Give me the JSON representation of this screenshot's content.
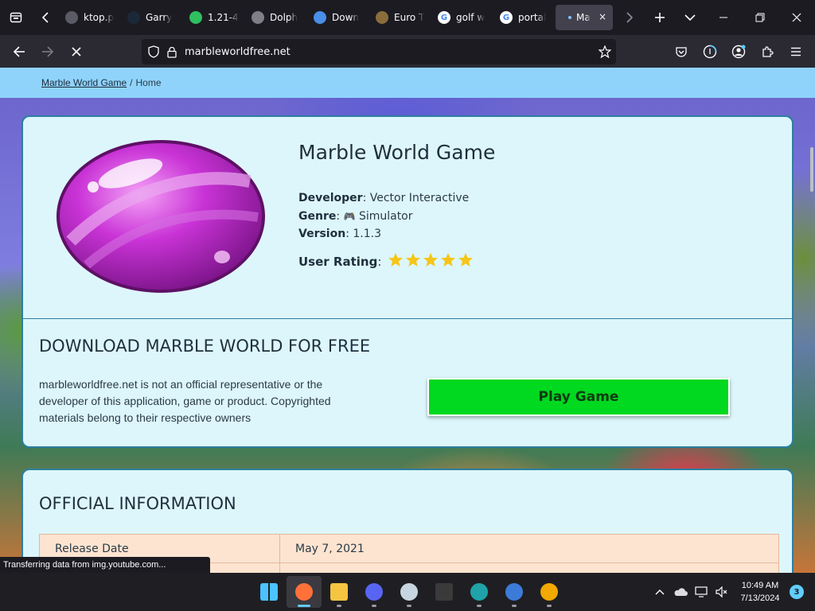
{
  "browser": {
    "tabs": [
      {
        "title": "ktop.p",
        "icon": "document-icon",
        "color": "#5b5b66"
      },
      {
        "title": "Garry",
        "icon": "steam-icon",
        "color": "#1b2838"
      },
      {
        "title": "1.21-4",
        "icon": "curseforge-icon",
        "color": "#2fbf5f"
      },
      {
        "title": "Dolph",
        "icon": "dolphin-icon",
        "color": "#7f7f88"
      },
      {
        "title": "Down",
        "icon": "download-icon",
        "color": "#4a8fe7"
      },
      {
        "title": "Euro T",
        "icon": "truck-icon",
        "color": "#8a6d3b"
      },
      {
        "title": "golf w",
        "icon": "google-icon",
        "color": "#ffffff"
      },
      {
        "title": "portal",
        "icon": "google-icon",
        "color": "#ffffff"
      }
    ],
    "active_tab": {
      "title": "Ma",
      "close_label": "×"
    },
    "url": "marbleworldfree.net"
  },
  "page": {
    "breadcrumb": {
      "home_link": "Marble World Game",
      "separator": "/",
      "current": "Home"
    },
    "game": {
      "title": "Marble World Game",
      "developer_label": "Developer",
      "developer": "Vector Interactive",
      "genre_label": "Genre",
      "genre_icon": "🎮",
      "genre": "Simulator",
      "version_label": "Version",
      "version": "1.1.3",
      "rating_label": "User Rating",
      "rating": 5,
      "rating_max": 5
    },
    "download": {
      "heading": "DOWNLOAD MARBLE WORLD FOR FREE",
      "disclaimer": "marbleworldfree.net is not an official representative or the developer of this application, game or product. Copyrighted materials belong to their respective owners",
      "button": "Play Game"
    },
    "info": {
      "heading": "OFFICIAL INFORMATION",
      "rows": [
        {
          "key": "Release Date",
          "value": "May 7, 2021"
        },
        {
          "key": "",
          "value": ""
        }
      ]
    },
    "status": "Transferring data from img.youtube.com..."
  },
  "taskbar": {
    "apps": [
      "windows-start-icon",
      "firefox-icon",
      "file-explorer-icon",
      "discord-icon",
      "steam-icon",
      "terminal-icon",
      "edge-icon",
      "qbittorrent-icon",
      "zenless-icon"
    ],
    "clock_time": "10:49 AM",
    "clock_date": "7/13/2024",
    "notification_count": "3"
  },
  "colors": {
    "accent": "#00d91f",
    "breadcrumb_bg": "#8fd3fb",
    "card_bg": "#ddf6fb",
    "card_border": "#2c7fa0",
    "star": "#f5c518"
  }
}
